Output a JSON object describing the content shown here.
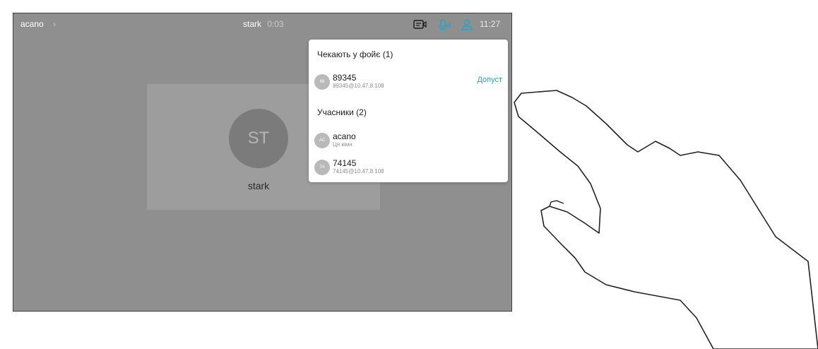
{
  "topbar": {
    "breadcrumb": "acano",
    "breadcrumb_chevron": "›",
    "call_name": "stark",
    "call_timer": "0:03",
    "clock": "11:27",
    "icons": [
      "screen-share-icon",
      "microphone-icon",
      "participants-icon"
    ]
  },
  "video": {
    "initials": "ST",
    "name": "stark"
  },
  "panel": {
    "lobby_title": "Чекають у фойє (1)",
    "lobby": [
      {
        "avatar_text": "89",
        "name": "89345",
        "address": "89345@10.47.8.108",
        "admit_label": "Допуст"
      }
    ],
    "participants_title": "Учасники (2)",
    "participants": [
      {
        "avatar_text": "AC",
        "name": "acano",
        "address": "Ця кімн"
      },
      {
        "avatar_text": "74",
        "name": "74145",
        "address": "74145@10.47.8.108"
      }
    ]
  },
  "colors": {
    "screen_bg": "#8f8f8f",
    "accent": "#1ea7cc",
    "icon_active": "#1ea7cc"
  }
}
